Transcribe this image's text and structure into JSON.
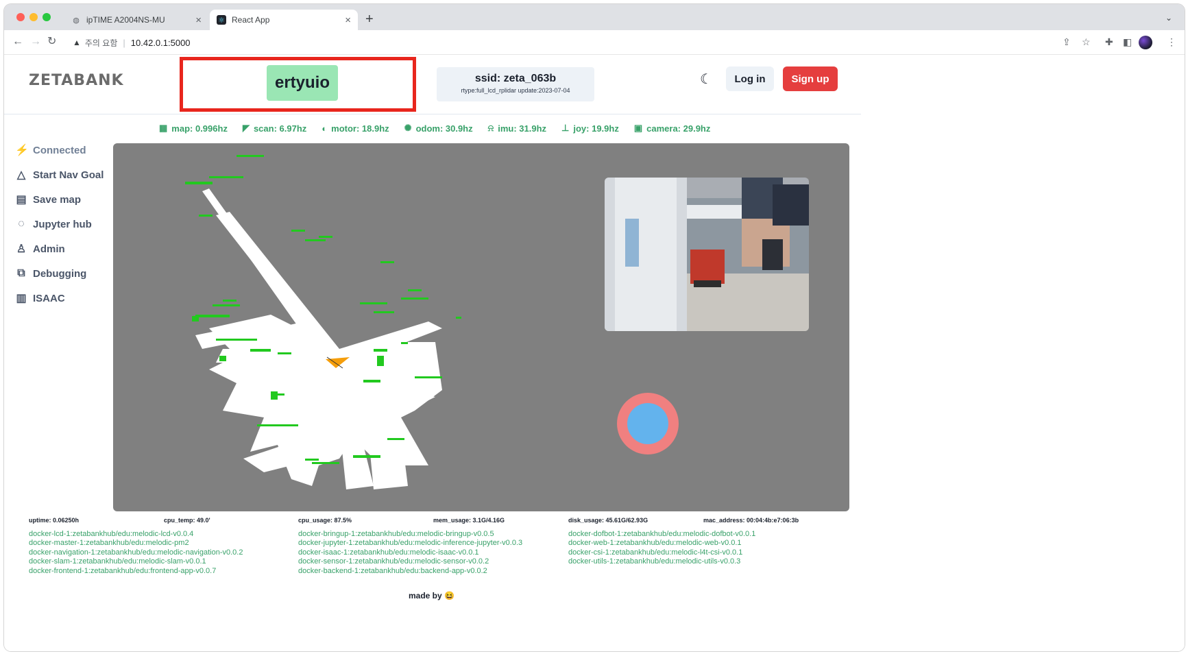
{
  "browser": {
    "tabs": [
      {
        "title": "ipTIME A2004NS-MU",
        "active": false
      },
      {
        "title": "React App",
        "active": true
      }
    ],
    "address": {
      "warning": "주의 요함",
      "url": "10.42.0.1:5000"
    }
  },
  "header": {
    "logo": "ZETABANK",
    "username": "ertyuio",
    "ssid_title": "ssid: zeta_063b",
    "ssid_sub": "rtype:full_lcd_rplidar update:2023-07-04",
    "login_label": "Log in",
    "signup_label": "Sign up"
  },
  "status": [
    {
      "icon": "grid-icon",
      "glyph": "▦",
      "text": "map: 0.996hz"
    },
    {
      "icon": "wifi-icon",
      "glyph": "◤",
      "text": "scan: 6.97hz"
    },
    {
      "icon": "motor-icon",
      "glyph": "◐",
      "text": "motor: 18.9hz"
    },
    {
      "icon": "sun-icon",
      "glyph": "✺",
      "text": "odom: 30.9hz"
    },
    {
      "icon": "imu-icon",
      "glyph": "⍾",
      "text": "imu: 31.9hz"
    },
    {
      "icon": "joystick-icon",
      "glyph": "⊥",
      "text": "joy: 19.9hz"
    },
    {
      "icon": "camera-icon",
      "glyph": "▣",
      "text": "camera: 29.9hz"
    }
  ],
  "sidebar": {
    "items": [
      {
        "label": "Connected",
        "icon": "connected-icon",
        "glyph": "⚡"
      },
      {
        "label": "Start Nav Goal",
        "icon": "navigation-icon",
        "glyph": "△"
      },
      {
        "label": "Save map",
        "icon": "map-icon",
        "glyph": "▤"
      },
      {
        "label": "Jupyter hub",
        "icon": "jupyter-icon",
        "glyph": "◌"
      },
      {
        "label": "Admin",
        "icon": "user-icon",
        "glyph": "♙"
      },
      {
        "label": "Debugging",
        "icon": "debug-icon",
        "glyph": "⧉"
      },
      {
        "label": "ISAAC",
        "icon": "bar-chart-icon",
        "glyph": "▥"
      }
    ]
  },
  "sysinfo": {
    "uptime": "uptime: 0.06250h",
    "cpu_temp": "cpu_temp: 49.0'",
    "cpu_usage": "cpu_usage: 87.5%",
    "mem_usage": "mem_usage: 3.1G/4.16G",
    "disk_usage": "disk_usage: 45.61G/62.93G",
    "mac_address": "mac_address: 00:04:4b:e7:06:3b"
  },
  "docker": {
    "col1": [
      "docker-lcd-1:zetabankhub/edu:melodic-lcd-v0.0.4",
      "docker-master-1:zetabankhub/edu:melodic-pm2",
      "docker-navigation-1:zetabankhub/edu:melodic-navigation-v0.0.2",
      "docker-slam-1:zetabankhub/edu:melodic-slam-v0.0.1",
      "docker-frontend-1:zetabankhub/edu:frontend-app-v0.0.7"
    ],
    "col2": [
      "docker-bringup-1:zetabankhub/edu:melodic-bringup-v0.0.5",
      "docker-jupyter-1:zetabankhub/edu:melodic-inference-jupyter-v0.0.3",
      "docker-isaac-1:zetabankhub/edu:melodic-isaac-v0.0.1",
      "docker-sensor-1:zetabankhub/edu:melodic-sensor-v0.0.2",
      "docker-backend-1:zetabankhub/edu:backend-app-v0.0.2"
    ],
    "col3": [
      "docker-dofbot-1:zetabankhub/edu:melodic-dofbot-v0.0.1",
      "docker-web-1:zetabankhub/edu:melodic-web-v0.0.1",
      "docker-csi-1:zetabankhub/edu:melodic-l4t-csi-v0.0.1",
      "docker-utils-1:zetabankhub/edu:melodic-utils-v0.0.3"
    ]
  },
  "footer": {
    "made_by": "made by 😆"
  }
}
